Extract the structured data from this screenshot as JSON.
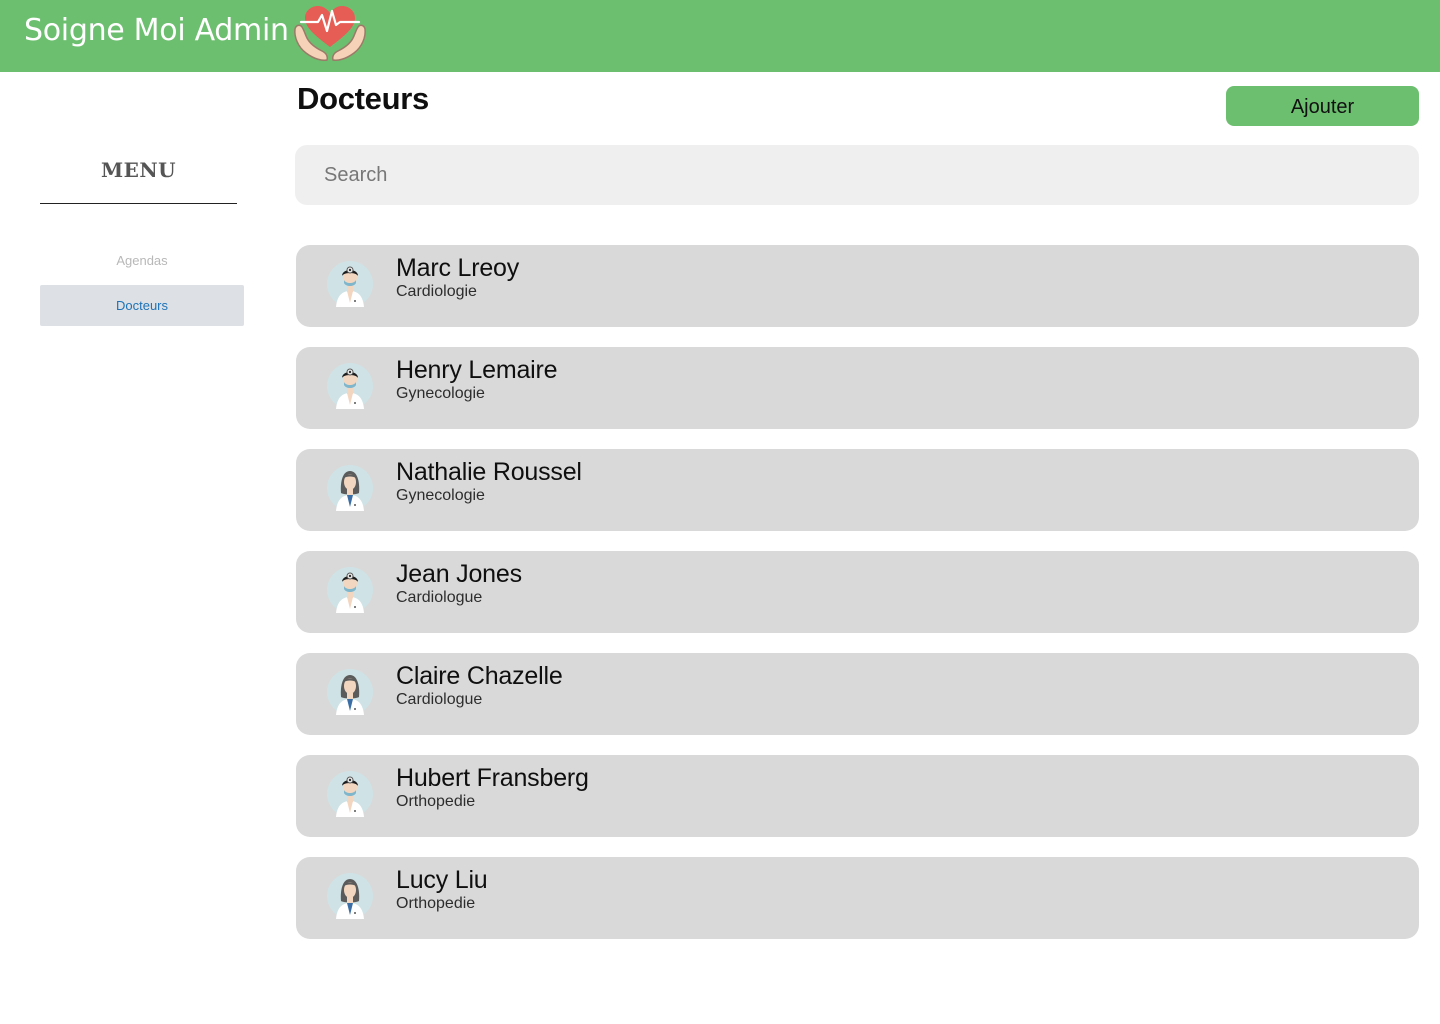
{
  "header": {
    "app_title": "Soigne Moi Admin",
    "logo_icon": "heart-hands-icon"
  },
  "sidebar": {
    "menu_title": "MENU",
    "items": [
      {
        "label": "Agendas",
        "active": false
      },
      {
        "label": "Docteurs",
        "active": true
      }
    ]
  },
  "main": {
    "title": "Docteurs",
    "add_button": "Ajouter",
    "search": {
      "placeholder": "Search",
      "value": ""
    },
    "doctors": [
      {
        "name": "Marc Lreoy",
        "specialty": "Cardiologie",
        "avatar": "male-doctor-icon"
      },
      {
        "name": "Henry Lemaire",
        "specialty": "Gynecologie",
        "avatar": "male-doctor-icon"
      },
      {
        "name": "Nathalie Roussel",
        "specialty": "Gynecologie",
        "avatar": "female-doctor-icon"
      },
      {
        "name": "Jean Jones",
        "specialty": "Cardiologue",
        "avatar": "male-doctor-icon"
      },
      {
        "name": "Claire Chazelle",
        "specialty": "Cardiologue",
        "avatar": "female-doctor-icon"
      },
      {
        "name": "Hubert Fransberg",
        "specialty": "Orthopedie",
        "avatar": "male-doctor-icon"
      },
      {
        "name": "Lucy Liu",
        "specialty": "Orthopedie",
        "avatar": "female-doctor-icon"
      }
    ]
  },
  "colors": {
    "brand_green": "#6dbf70",
    "card_gray": "#d9d9d9",
    "search_bg": "#efefef",
    "active_nav_bg": "#dde0e4",
    "active_nav_text": "#1e73b8"
  }
}
